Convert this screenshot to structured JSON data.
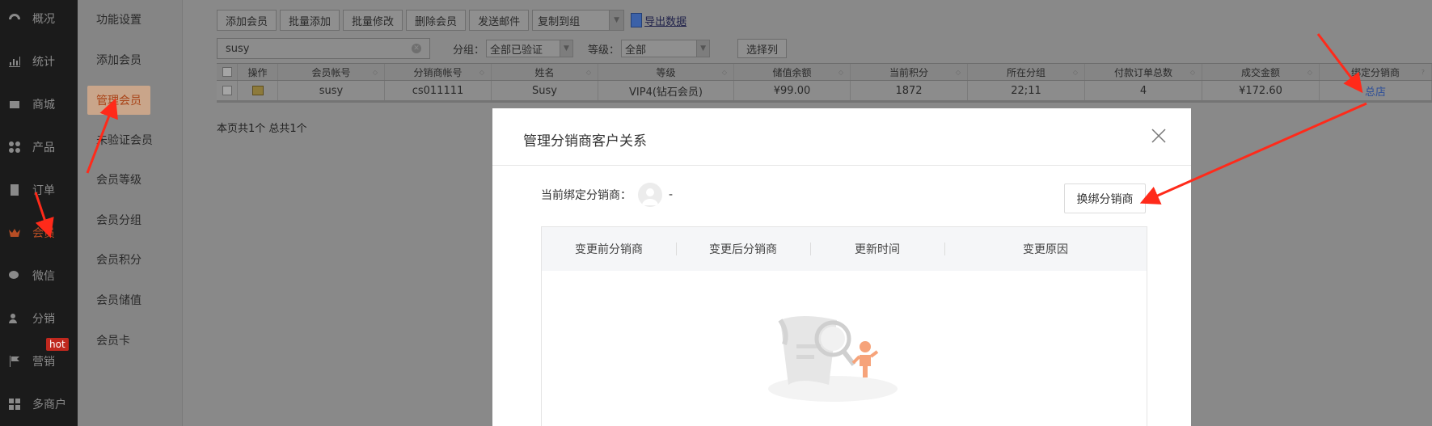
{
  "left_nav": {
    "items": [
      {
        "label": "概况",
        "icon": "dashboard-icon"
      },
      {
        "label": "统计",
        "icon": "chart-icon"
      },
      {
        "label": "商城",
        "icon": "mall-icon"
      },
      {
        "label": "产品",
        "icon": "product-icon"
      },
      {
        "label": "订单",
        "icon": "order-icon"
      },
      {
        "label": "会员",
        "icon": "crown-icon"
      },
      {
        "label": "微信",
        "icon": "wechat-icon"
      },
      {
        "label": "分销",
        "icon": "distribution-icon"
      },
      {
        "label": "营销",
        "icon": "flag-icon"
      },
      {
        "label": "多商户",
        "icon": "multi-merchant-icon"
      }
    ],
    "active": "会员",
    "hot_badge": "hot"
  },
  "sub_nav": {
    "items": [
      "功能设置",
      "添加会员",
      "管理会员",
      "未验证会员",
      "会员等级",
      "会员分组",
      "会员积分",
      "会员储值",
      "会员卡"
    ],
    "active": "管理会员"
  },
  "toolbar": {
    "buttons": [
      "添加会员",
      "批量添加",
      "批量修改",
      "删除会员",
      "发送邮件"
    ],
    "copy_select": "复制到组",
    "export_label": "导出数据"
  },
  "filters": {
    "search_value": "susy",
    "group_label": "分组：",
    "group_value": "全部已验证",
    "level_label": "等级：",
    "level_value": "全部",
    "select_columns": "选择列"
  },
  "table": {
    "headers": [
      "操作",
      "会员帐号",
      "分销商帐号",
      "姓名",
      "等级",
      "储值余额",
      "当前积分",
      "所在分组",
      "付款订单总数",
      "成交金额",
      "绑定分销商"
    ],
    "rows": [
      [
        "susy",
        "cs011111",
        "Susy",
        "VIP4(钻石会员)",
        "¥99.00",
        "1872",
        "22;11",
        "4",
        "¥172.60",
        "总店"
      ]
    ],
    "page_info": "本页共1个 总共1个"
  },
  "modal": {
    "title": "管理分销商客户关系",
    "current_label": "当前绑定分销商：",
    "current_value": "-",
    "rebind_button": "换绑分销商",
    "headers": [
      "变更前分销商",
      "变更后分销商",
      "更新时间",
      "变更原因"
    ]
  },
  "colors": {
    "accent": "#b64d24",
    "annotation_arrow": "#ff2a1a"
  }
}
